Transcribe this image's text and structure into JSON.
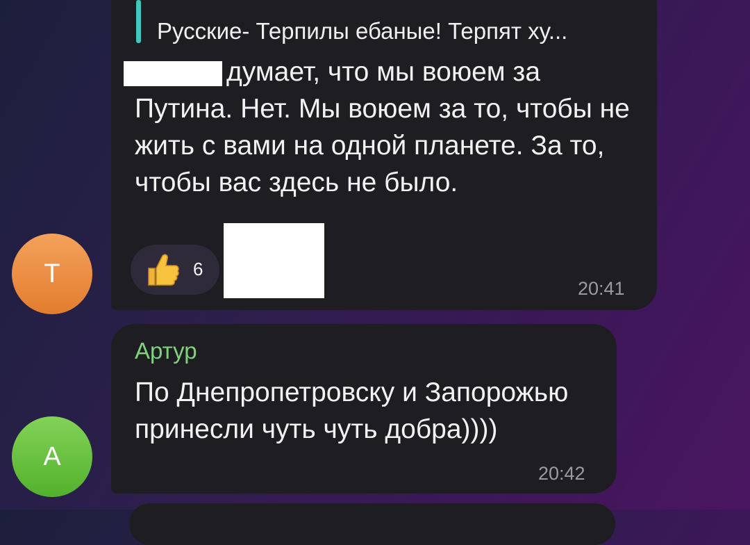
{
  "chat": {
    "messages": [
      {
        "reply_preview": "Русские- Терпилы ебаные! Терпят ху...",
        "text": "думает, что мы воюем за Путина. Нет. Мы воюем за то, чтобы не жить с вами на одной планете. За то, чтобы вас здесь не было.",
        "reaction": {
          "icon": "thumbs-up-icon",
          "count": "6"
        },
        "time": "20:41",
        "avatar_letter": "Т",
        "avatar_color": "#e8893a"
      },
      {
        "sender": "Артур",
        "sender_color": "#7ed37a",
        "text": "По Днепропетровску и Запорожью принесли чуть чуть добра))))",
        "time": "20:42",
        "avatar_letter": "А",
        "avatar_color": "#62c03a"
      }
    ]
  }
}
